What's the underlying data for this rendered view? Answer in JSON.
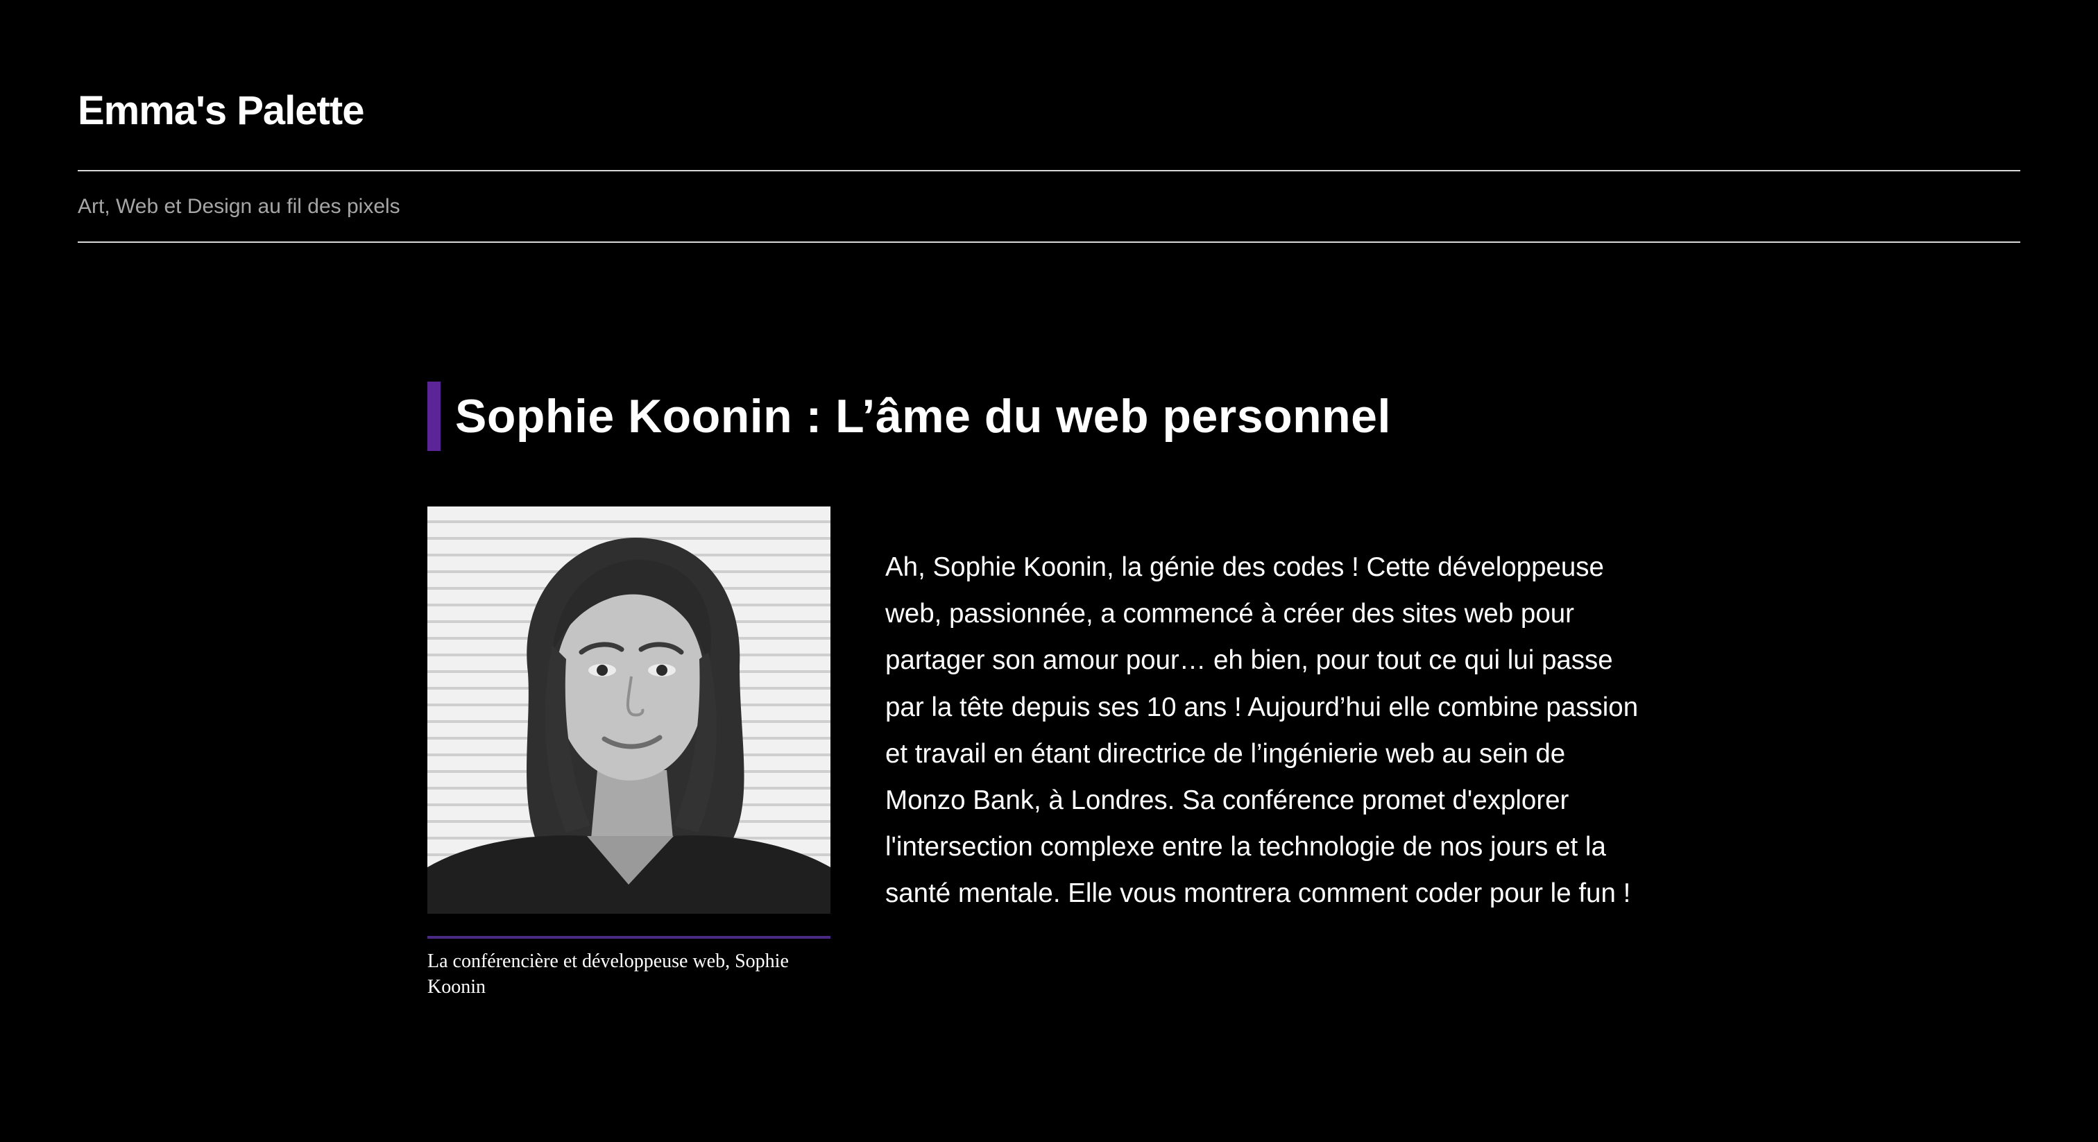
{
  "header": {
    "site_title": "Emma's Palette",
    "tagline": "Art, Web et Design au fil des pixels"
  },
  "article": {
    "title": "Sophie Koonin : L’âme du web personnel",
    "figure": {
      "caption": "La conférencière et développeuse web, Sophie Koonin"
    },
    "body_lines": [
      "Ah, Sophie Koonin, la génie des codes ! Cette développeuse",
      "web, passionnée, a commencé à créer des sites web pour",
      "partager son amour pour… eh bien, pour tout ce qui lui passe",
      "par la tête depuis ses 10 ans ! Aujourd’hui elle combine passion",
      "et travail en étant directrice de l’ingénierie web au sein de",
      "Monzo Bank, à Londres. Sa conférence promet d'explorer",
      "l'intersection complexe entre la technologie de nos jours et la",
      "santé mentale. Elle vous montrera comment coder pour le fun !"
    ]
  },
  "colors": {
    "background": "#000000",
    "text": "#ffffff",
    "tagline": "#a6a6a6",
    "accent": "#5b2597",
    "rule": "#d9d9d9"
  }
}
